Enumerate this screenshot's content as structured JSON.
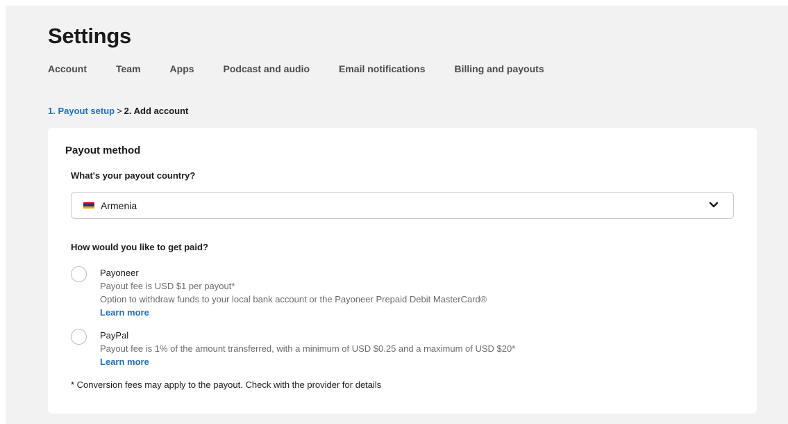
{
  "header": {
    "title": "Settings",
    "tabs": [
      {
        "label": "Account"
      },
      {
        "label": "Team"
      },
      {
        "label": "Apps"
      },
      {
        "label": "Podcast and audio"
      },
      {
        "label": "Email notifications"
      },
      {
        "label": "Billing and payouts"
      }
    ]
  },
  "breadcrumb": {
    "step1": "1. Payout setup",
    "separator": ">",
    "step2": "2. Add account"
  },
  "payout": {
    "title": "Payout method",
    "country_question": "What's your payout country?",
    "country": {
      "value": "Armenia",
      "flag_colors": [
        "#d90012",
        "#0033a0",
        "#f2a800"
      ],
      "icon": "chevron-down-icon"
    },
    "method_question": "How would you like to get paid?",
    "options": [
      {
        "name": "Payoneer",
        "lines": [
          "Payout fee is USD $1 per payout*",
          "Option to withdraw funds to your local bank account or the Payoneer Prepaid Debit MasterCard®"
        ],
        "link": "Learn more",
        "selected": false
      },
      {
        "name": "PayPal",
        "lines": [
          "Payout fee is 1% of the amount transferred, with a minimum of USD $0.25 and a maximum of USD $20*"
        ],
        "link": "Learn more",
        "selected": false
      }
    ],
    "footnote": "* Conversion fees may apply to the payout. Check with the provider for details"
  },
  "colors": {
    "accent": "#1f6fbf",
    "page_background": "#f2f2f2",
    "card_background": "#ffffff"
  }
}
